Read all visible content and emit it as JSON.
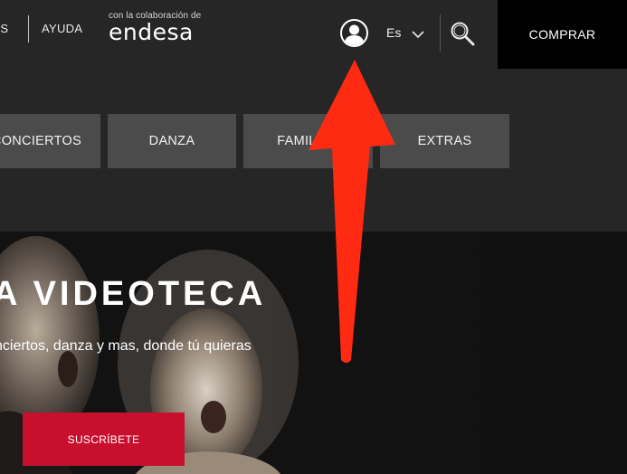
{
  "header": {
    "nav": [
      {
        "label": "OS"
      },
      {
        "label": "AYUDA"
      }
    ],
    "sponsor_tag": "con la colaboración de",
    "sponsor_logo": "endesa",
    "language": "Es",
    "buy_label": "COMPRAR",
    "icons": [
      "user-icon",
      "chevron-down-icon",
      "search-icon"
    ]
  },
  "categories": [
    {
      "label": "CONCIERTOS"
    },
    {
      "label": "DANZA"
    },
    {
      "label": "FAMILIAR"
    },
    {
      "label": "EXTRAS"
    }
  ],
  "hero": {
    "title": "A VIDEOTECA",
    "subtitle": "nciertos, danza y mas, donde tú quieras",
    "cta_label": "SUSCRÍBETE"
  },
  "colors": {
    "background": "#262626",
    "tab": "#4b4b4b",
    "cta": "#c8102e",
    "buy": "#000000",
    "annotation_arrow": "#ff2a12"
  }
}
